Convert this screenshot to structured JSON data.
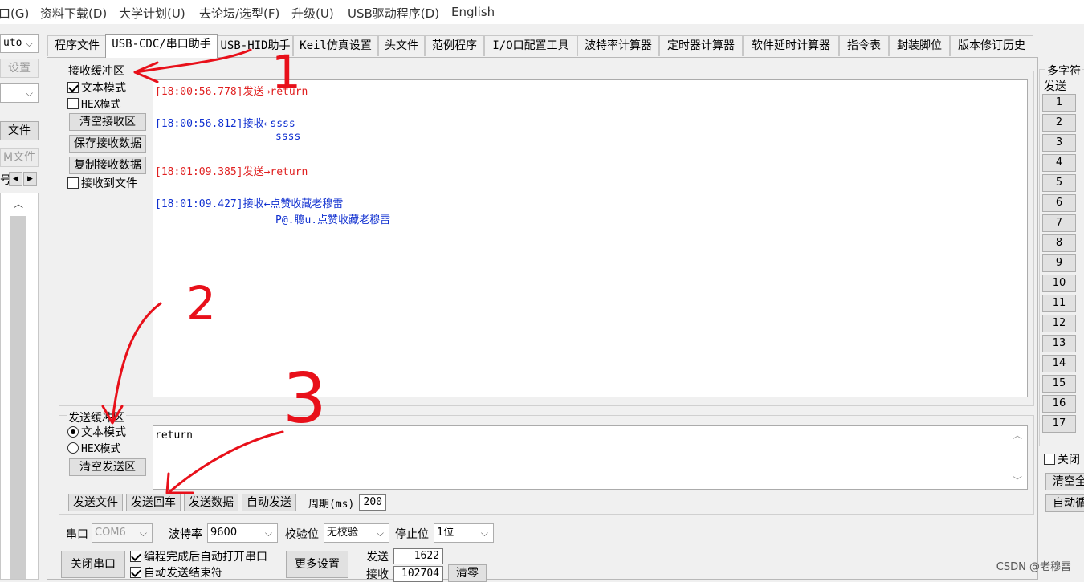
{
  "menu": [
    "口(G)",
    "资料下载(D)",
    "大学计划(U)",
    "去论坛/选型(F)",
    "升级(U)",
    "USB驱动程序(D)",
    "English"
  ],
  "left_strip": {
    "auto_combo": "uto",
    "settings_btn": "设置",
    "file_btn": "文件",
    "file_btn2": "M文件",
    "num_label": "号"
  },
  "tabs": [
    "程序文件",
    "USB-CDC/串口助手",
    "USB-HID助手",
    "Keil仿真设置",
    "头文件",
    "范例程序",
    "I/O口配置工具",
    "波特率计算器",
    "定时器计算器",
    "软件延时计算器",
    "指令表",
    "封装脚位",
    "版本修订历史"
  ],
  "receive": {
    "title": "接收缓冲区",
    "text_mode": "文本模式",
    "hex_mode": "HEX模式",
    "clear_btn": "清空接收区",
    "save_btn": "保存接收数据",
    "copy_btn": "复制接收数据",
    "to_file": "接收到文件",
    "lines": [
      {
        "time": "[18:00:56.778]发送→",
        "text": "return"
      },
      {
        "time": "[18:00:56.812]接收←",
        "text": "ssss"
      },
      {
        "time": "",
        "text": "ssss"
      },
      {
        "time": "[18:01:09.385]发送→",
        "text": "return"
      },
      {
        "time": "[18:01:09.427]接收←",
        "text": "点赞收藏老穆雷"
      },
      {
        "time": "",
        "text": "P@.聰u.点赞收藏老穆雷"
      }
    ]
  },
  "send": {
    "title": "发送缓冲区",
    "text_mode": "文本模式",
    "hex_mode": "HEX模式",
    "clear_btn": "清空发送区",
    "content": "return",
    "send_file_btn": "发送文件",
    "send_enter_btn": "发送回车",
    "send_data_btn": "发送数据",
    "auto_send_btn": "自动发送",
    "period_label": "周期(ms)",
    "period_value": "200"
  },
  "serial": {
    "port_label": "串口",
    "port_value": "COM6",
    "baud_label": "波特率",
    "baud_value": "9600",
    "parity_label": "校验位",
    "parity_value": "无校验",
    "stop_label": "停止位",
    "stop_value": "1位",
    "close_btn": "关闭串口",
    "auto_open": "编程完成后自动打开串口",
    "auto_end": "自动发送结束符",
    "more_btn": "更多设置",
    "sent_label": "发送",
    "sent_value": "1622",
    "recv_label": "接收",
    "recv_value": "102704",
    "clear_btn": "清零"
  },
  "multi": {
    "title": "多字符",
    "send_label": "发送",
    "buttons": [
      "1",
      "2",
      "3",
      "4",
      "5",
      "6",
      "7",
      "8",
      "9",
      "10",
      "11",
      "12",
      "13",
      "14",
      "15",
      "16",
      "17"
    ],
    "close_chk": "关闭",
    "clear_all": "清空全",
    "auto_btn": "自动循"
  },
  "annotations": [
    "1",
    "2",
    "3"
  ],
  "watermark": "CSDN @老穆雷",
  "colors": {
    "send_text": "#e02020",
    "recv_text": "#1030d0",
    "annotation": "#e8101a"
  }
}
